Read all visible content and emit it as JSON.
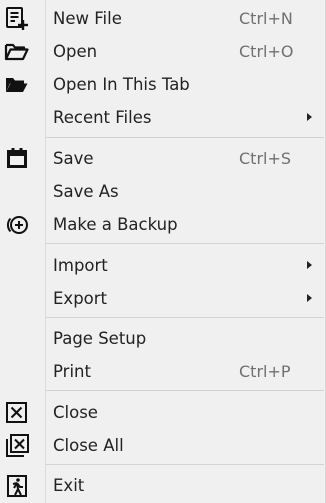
{
  "menu": {
    "items": [
      {
        "label": "New File",
        "shortcut": "Ctrl+N",
        "icon": "new-file-icon"
      },
      {
        "label": "Open",
        "shortcut": "Ctrl+O",
        "icon": "open-folder-icon"
      },
      {
        "label": "Open In This Tab",
        "shortcut": "",
        "icon": "open-folder-filled-icon"
      },
      {
        "label": "Recent Files",
        "shortcut": "",
        "icon": "",
        "submenu": true
      },
      {
        "label": "Save",
        "shortcut": "Ctrl+S",
        "icon": "save-icon"
      },
      {
        "label": "Save As",
        "shortcut": "",
        "icon": ""
      },
      {
        "label": "Make a Backup",
        "shortcut": "",
        "icon": "backup-icon"
      },
      {
        "label": "Import",
        "shortcut": "",
        "icon": "",
        "submenu": true
      },
      {
        "label": "Export",
        "shortcut": "",
        "icon": "",
        "submenu": true
      },
      {
        "label": "Page Setup",
        "shortcut": "",
        "icon": ""
      },
      {
        "label": "Print",
        "shortcut": "Ctrl+P",
        "icon": ""
      },
      {
        "label": "Close",
        "shortcut": "",
        "icon": "close-icon"
      },
      {
        "label": "Close All",
        "shortcut": "",
        "icon": "close-all-icon"
      },
      {
        "label": "Exit",
        "shortcut": "",
        "icon": "exit-icon"
      }
    ]
  }
}
